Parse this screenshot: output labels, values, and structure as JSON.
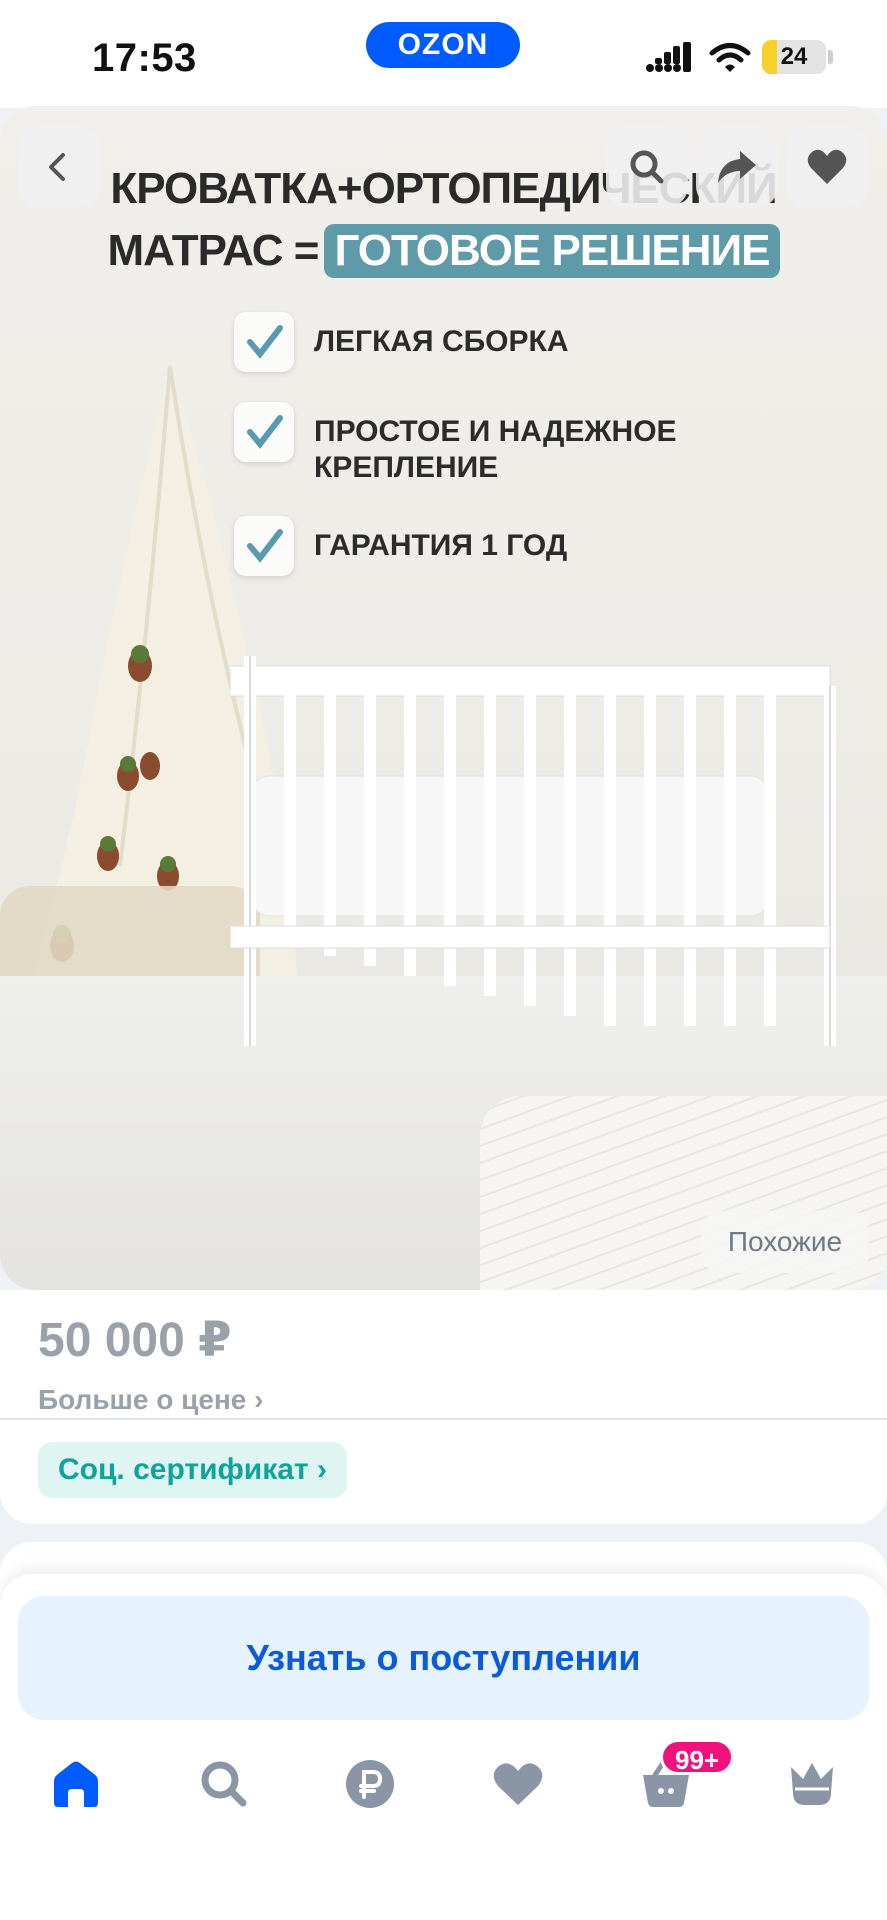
{
  "status_bar": {
    "time": "17:53",
    "brand": "OZON",
    "battery": "24",
    "battery_level": 0.24
  },
  "gallery": {
    "headline_line1": "КРОВАТКА+ОРТОПЕДИЧЕСКИЙ",
    "headline_line2_prefix": "МАТРАС =",
    "headline_line2_highlight": "ГОТОВОЕ РЕШЕНИЕ",
    "features": [
      {
        "label": "ЛЕГКАЯ СБОРКА"
      },
      {
        "label": "ПРОСТОЕ И НАДЕЖНОЕ КРЕПЛЕНИЕ"
      },
      {
        "label": "ГАРАНТИЯ 1 ГОД"
      }
    ],
    "similar_label": "Похожие",
    "icons": {
      "back": "back-arrow-icon",
      "search": "search-icon",
      "share": "share-icon",
      "favorite": "heart-icon"
    }
  },
  "product": {
    "price": "50 000 ₽",
    "more_price": "Больше о цене",
    "certificate": "Соц. сертификат"
  },
  "bottom_sheet": {
    "notify_button": "Узнать о поступлении"
  },
  "tab_bar": {
    "items": [
      {
        "name": "home",
        "icon": "home-icon"
      },
      {
        "name": "search",
        "icon": "search-icon"
      },
      {
        "name": "finance",
        "icon": "ruble-icon"
      },
      {
        "name": "favorites",
        "icon": "heart-icon"
      },
      {
        "name": "cart",
        "icon": "cart-icon"
      },
      {
        "name": "profile",
        "icon": "crown-icon"
      }
    ],
    "cart_badge": "99+",
    "colors": {
      "active": "#005bff",
      "inactive": "#8a96a6",
      "badge": "#f1117e"
    }
  }
}
